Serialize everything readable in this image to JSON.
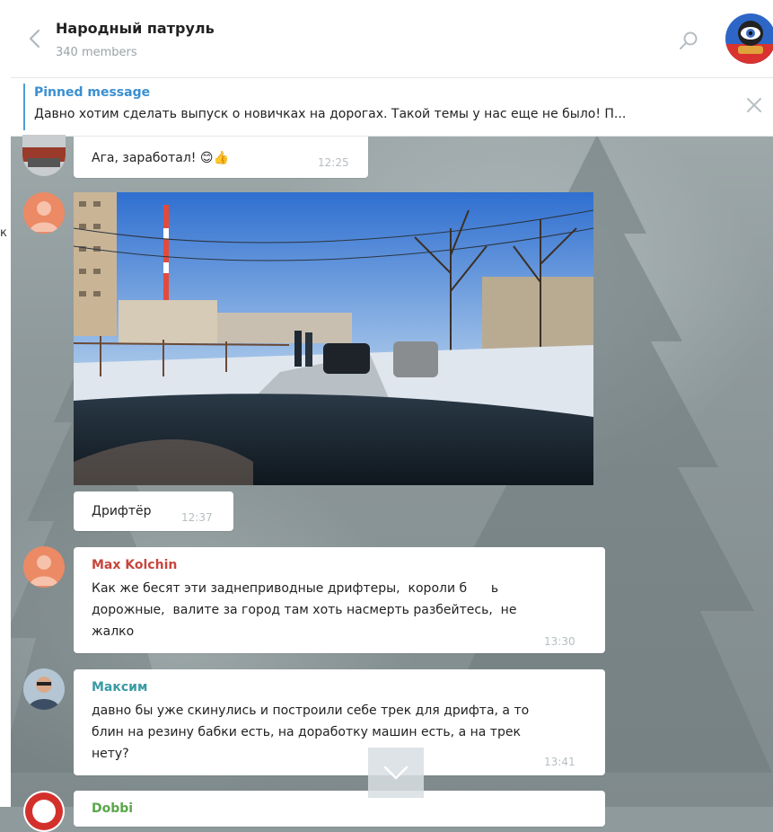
{
  "header": {
    "title": "Народный патруль",
    "members": "340 members"
  },
  "pinned": {
    "label": "Pinned message",
    "text": "Давно хотим сделать выпуск о новичках на дорогах. Такой темы у нас еще не было! П..."
  },
  "messages": [
    {
      "text": "Ага, заработал! 😊👍",
      "time": "12:25"
    },
    {
      "text": "Дрифтёр",
      "time": "12:37"
    },
    {
      "sender": "Max Kolchin",
      "lines": [
        "Как же бесят эти заднеприводные дрифтеры,  короли б      ь",
        "дорожные,  валите за город там хоть насмерть разбейтесь,  не",
        "жалко"
      ],
      "time": "13:30"
    },
    {
      "sender": "Максим",
      "lines": [
        "давно бы уже скинулись и построили себе трек для дрифта, а то",
        "блин на резину бабки есть, на доработку машин есть, а на трек",
        "нету?"
      ],
      "time": "13:41"
    }
  ],
  "partial_sender": "Dobbi",
  "left_edge_char": "к",
  "colors": {
    "accent": "#3a8fd1",
    "sender_max_kolchin": "#c9463d",
    "sender_maksim": "#3a9aa5",
    "avatar_orange": "#ec8a66"
  }
}
